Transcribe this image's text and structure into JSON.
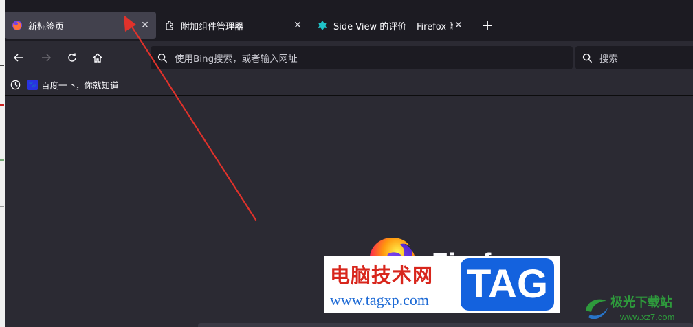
{
  "tabs": [
    {
      "title": "新标签页",
      "icon": "firefox-icon",
      "active": true
    },
    {
      "title": "附加组件管理器",
      "icon": "puzzle-icon",
      "active": false
    },
    {
      "title": "Side View 的评价 – Firefox 附加",
      "icon": "side-view-icon",
      "active": false
    }
  ],
  "urlbar": {
    "placeholder": "使用Bing搜索，或者输入网址"
  },
  "searchbar": {
    "placeholder": "搜索"
  },
  "bookmarks": [
    {
      "label": "百度一下，你就知道",
      "icon": "baidu-icon"
    }
  ],
  "branding": {
    "wordmark": "Firefox"
  },
  "watermark": {
    "cn": "电脑技术网",
    "url": "www.tagxp.com",
    "tag": "TAG",
    "site2": "极光下载站",
    "site2_url": "www.xz7.com"
  },
  "colors": {
    "tabbar": "#1c1b22",
    "toolbar": "#2b2a33",
    "active_tab": "#42414d",
    "arrow": "#e0322b"
  }
}
